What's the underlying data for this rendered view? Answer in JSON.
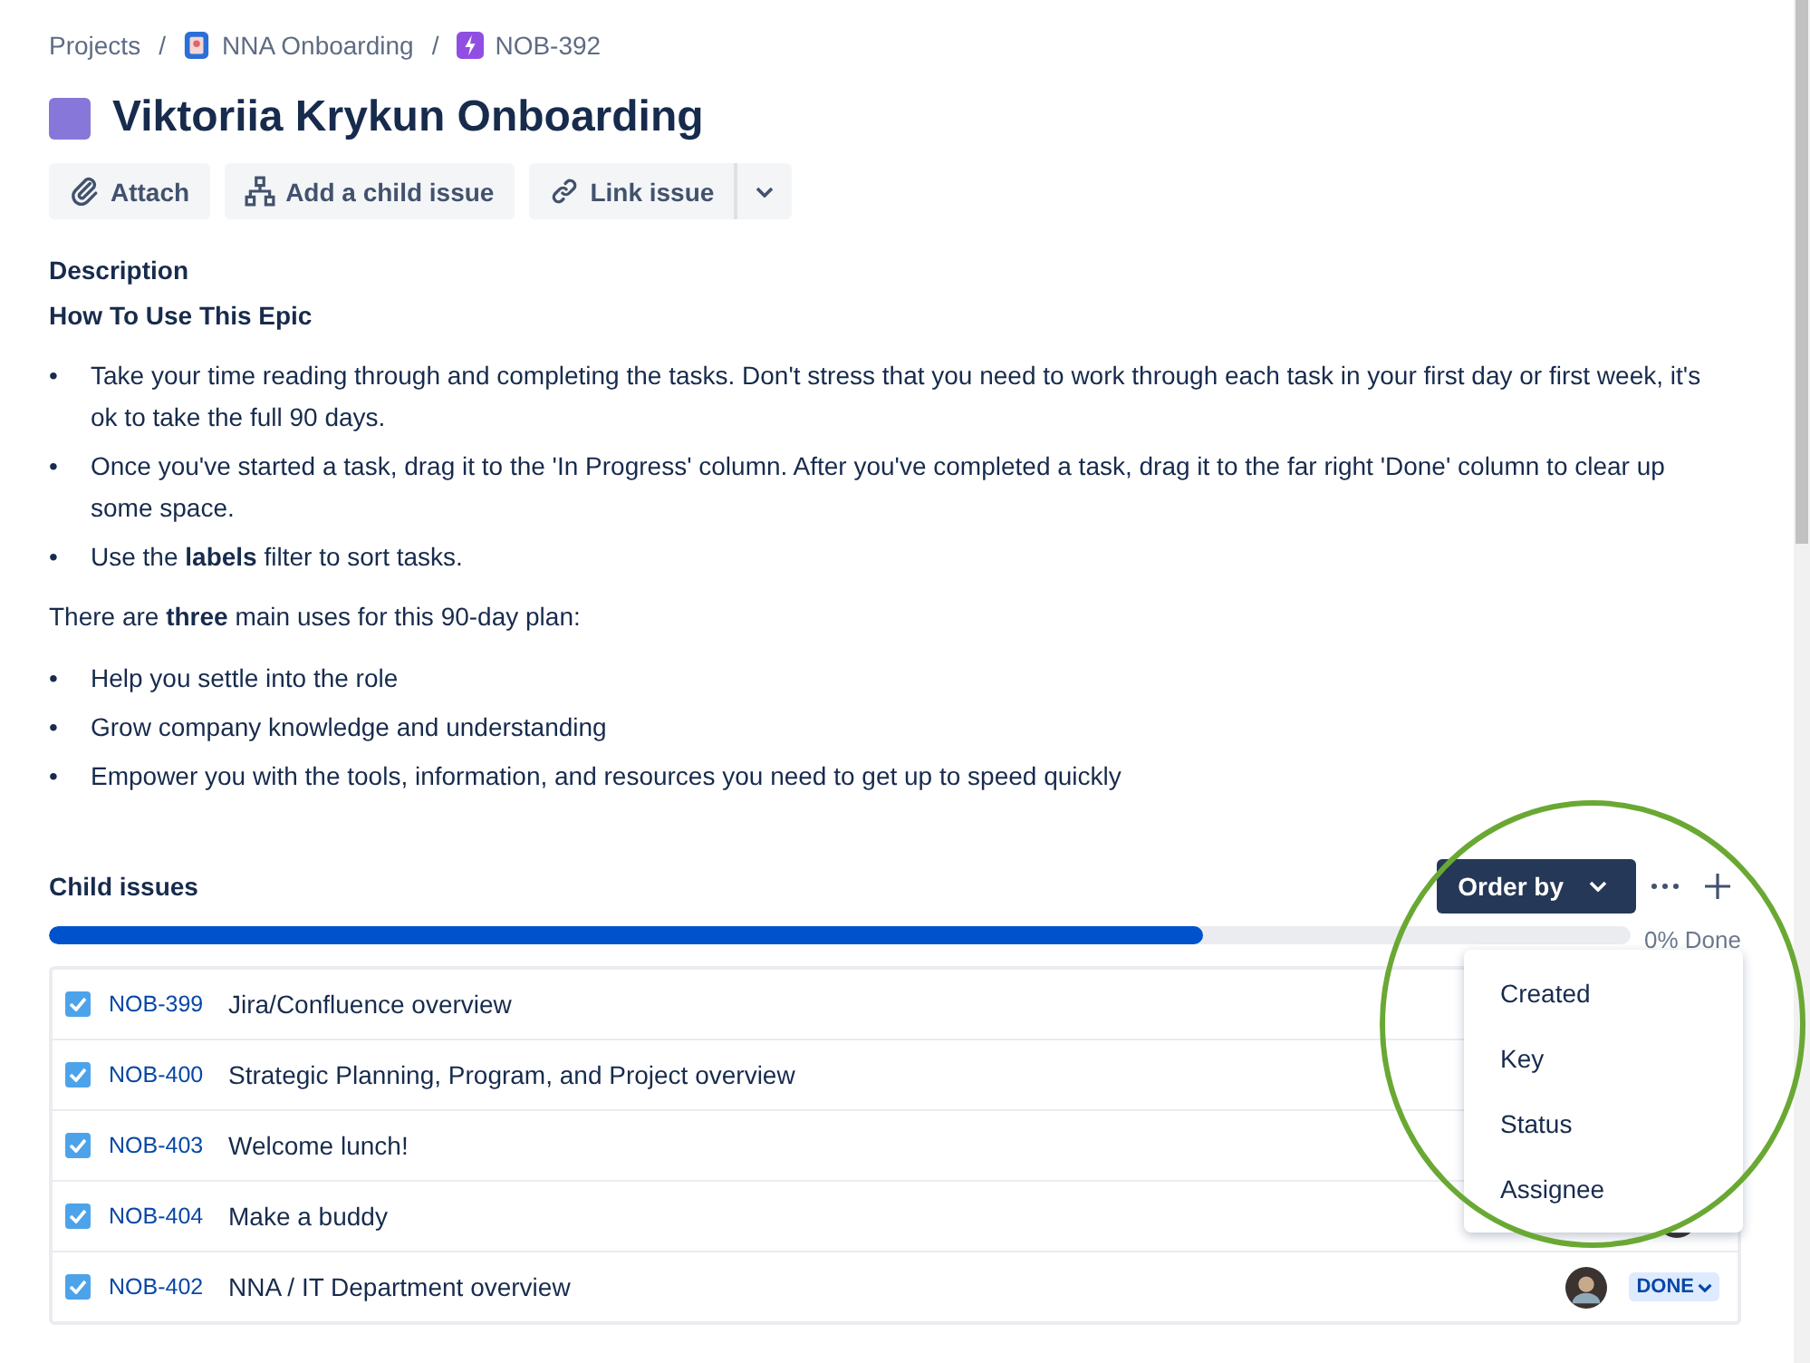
{
  "breadcrumbs": [
    {
      "label": "Projects"
    },
    {
      "separator": "/",
      "label": "NNA Onboarding"
    },
    {
      "separator": "/",
      "label": "NOB-392"
    }
  ],
  "title": "Viktoriia Krykun Onboarding",
  "actions": [
    {
      "label": "Attach"
    },
    {
      "label": "Add a child issue"
    },
    {
      "label": "Link issue"
    }
  ],
  "description": {
    "label": "Description",
    "heading": "How To Use This Epic",
    "marker": "•",
    "bullets": [
      "Take your time reading through and completing the tasks. Don't stress that you need to work through each task in your first day or first week, it's ok to take the full 90 days.",
      "Once you've started a task, drag it to the 'In Progress' column. After you've completed a task, drag it to the far right 'Done' column to clear up some space.",
      "Use the **labels** filter to sort tasks."
    ],
    "intro": "There are **three** main uses for this 90-day plan:",
    "uses": [
      "Help you settle into the role",
      "Grow company knowledge and understanding",
      "Empower you with the tools, information, and resources you need to get up to speed quickly"
    ]
  },
  "child_issues": {
    "label": "Child issues",
    "order_button": "Order by",
    "progress": {
      "level": 0.73,
      "reading": "0% Done"
    },
    "rows": [
      {
        "checked": true,
        "key": "NOB-399",
        "summary": "Jira/Confluence overview",
        "avatar": false
      },
      {
        "checked": true,
        "key": "NOB-400",
        "summary": "Strategic Planning, Program, and Project overview",
        "avatar": false
      },
      {
        "checked": true,
        "key": "NOB-403",
        "summary": "Welcome lunch!",
        "avatar": false
      },
      {
        "checked": true,
        "key": "NOB-404",
        "summary": "Make a buddy",
        "avatar": true
      },
      {
        "checked": true,
        "key": "NOB-402",
        "summary": "NNA / IT Department overview",
        "avatar": true,
        "status": "DONE"
      }
    ]
  },
  "order_menu": {
    "items": [
      "Created",
      "Key",
      "Status",
      "Assignee"
    ]
  }
}
